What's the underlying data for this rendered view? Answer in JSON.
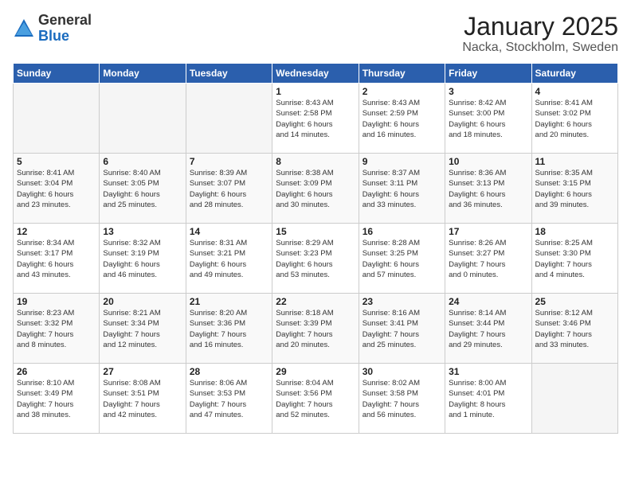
{
  "logo": {
    "general": "General",
    "blue": "Blue"
  },
  "title": {
    "month": "January 2025",
    "location": "Nacka, Stockholm, Sweden"
  },
  "days_header": [
    "Sunday",
    "Monday",
    "Tuesday",
    "Wednesday",
    "Thursday",
    "Friday",
    "Saturday"
  ],
  "weeks": [
    [
      {
        "day": "",
        "info": ""
      },
      {
        "day": "",
        "info": ""
      },
      {
        "day": "",
        "info": ""
      },
      {
        "day": "1",
        "info": "Sunrise: 8:43 AM\nSunset: 2:58 PM\nDaylight: 6 hours\nand 14 minutes."
      },
      {
        "day": "2",
        "info": "Sunrise: 8:43 AM\nSunset: 2:59 PM\nDaylight: 6 hours\nand 16 minutes."
      },
      {
        "day": "3",
        "info": "Sunrise: 8:42 AM\nSunset: 3:00 PM\nDaylight: 6 hours\nand 18 minutes."
      },
      {
        "day": "4",
        "info": "Sunrise: 8:41 AM\nSunset: 3:02 PM\nDaylight: 6 hours\nand 20 minutes."
      }
    ],
    [
      {
        "day": "5",
        "info": "Sunrise: 8:41 AM\nSunset: 3:04 PM\nDaylight: 6 hours\nand 23 minutes."
      },
      {
        "day": "6",
        "info": "Sunrise: 8:40 AM\nSunset: 3:05 PM\nDaylight: 6 hours\nand 25 minutes."
      },
      {
        "day": "7",
        "info": "Sunrise: 8:39 AM\nSunset: 3:07 PM\nDaylight: 6 hours\nand 28 minutes."
      },
      {
        "day": "8",
        "info": "Sunrise: 8:38 AM\nSunset: 3:09 PM\nDaylight: 6 hours\nand 30 minutes."
      },
      {
        "day": "9",
        "info": "Sunrise: 8:37 AM\nSunset: 3:11 PM\nDaylight: 6 hours\nand 33 minutes."
      },
      {
        "day": "10",
        "info": "Sunrise: 8:36 AM\nSunset: 3:13 PM\nDaylight: 6 hours\nand 36 minutes."
      },
      {
        "day": "11",
        "info": "Sunrise: 8:35 AM\nSunset: 3:15 PM\nDaylight: 6 hours\nand 39 minutes."
      }
    ],
    [
      {
        "day": "12",
        "info": "Sunrise: 8:34 AM\nSunset: 3:17 PM\nDaylight: 6 hours\nand 43 minutes."
      },
      {
        "day": "13",
        "info": "Sunrise: 8:32 AM\nSunset: 3:19 PM\nDaylight: 6 hours\nand 46 minutes."
      },
      {
        "day": "14",
        "info": "Sunrise: 8:31 AM\nSunset: 3:21 PM\nDaylight: 6 hours\nand 49 minutes."
      },
      {
        "day": "15",
        "info": "Sunrise: 8:29 AM\nSunset: 3:23 PM\nDaylight: 6 hours\nand 53 minutes."
      },
      {
        "day": "16",
        "info": "Sunrise: 8:28 AM\nSunset: 3:25 PM\nDaylight: 6 hours\nand 57 minutes."
      },
      {
        "day": "17",
        "info": "Sunrise: 8:26 AM\nSunset: 3:27 PM\nDaylight: 7 hours\nand 0 minutes."
      },
      {
        "day": "18",
        "info": "Sunrise: 8:25 AM\nSunset: 3:30 PM\nDaylight: 7 hours\nand 4 minutes."
      }
    ],
    [
      {
        "day": "19",
        "info": "Sunrise: 8:23 AM\nSunset: 3:32 PM\nDaylight: 7 hours\nand 8 minutes."
      },
      {
        "day": "20",
        "info": "Sunrise: 8:21 AM\nSunset: 3:34 PM\nDaylight: 7 hours\nand 12 minutes."
      },
      {
        "day": "21",
        "info": "Sunrise: 8:20 AM\nSunset: 3:36 PM\nDaylight: 7 hours\nand 16 minutes."
      },
      {
        "day": "22",
        "info": "Sunrise: 8:18 AM\nSunset: 3:39 PM\nDaylight: 7 hours\nand 20 minutes."
      },
      {
        "day": "23",
        "info": "Sunrise: 8:16 AM\nSunset: 3:41 PM\nDaylight: 7 hours\nand 25 minutes."
      },
      {
        "day": "24",
        "info": "Sunrise: 8:14 AM\nSunset: 3:44 PM\nDaylight: 7 hours\nand 29 minutes."
      },
      {
        "day": "25",
        "info": "Sunrise: 8:12 AM\nSunset: 3:46 PM\nDaylight: 7 hours\nand 33 minutes."
      }
    ],
    [
      {
        "day": "26",
        "info": "Sunrise: 8:10 AM\nSunset: 3:49 PM\nDaylight: 7 hours\nand 38 minutes."
      },
      {
        "day": "27",
        "info": "Sunrise: 8:08 AM\nSunset: 3:51 PM\nDaylight: 7 hours\nand 42 minutes."
      },
      {
        "day": "28",
        "info": "Sunrise: 8:06 AM\nSunset: 3:53 PM\nDaylight: 7 hours\nand 47 minutes."
      },
      {
        "day": "29",
        "info": "Sunrise: 8:04 AM\nSunset: 3:56 PM\nDaylight: 7 hours\nand 52 minutes."
      },
      {
        "day": "30",
        "info": "Sunrise: 8:02 AM\nSunset: 3:58 PM\nDaylight: 7 hours\nand 56 minutes."
      },
      {
        "day": "31",
        "info": "Sunrise: 8:00 AM\nSunset: 4:01 PM\nDaylight: 8 hours\nand 1 minute."
      },
      {
        "day": "",
        "info": ""
      }
    ]
  ]
}
